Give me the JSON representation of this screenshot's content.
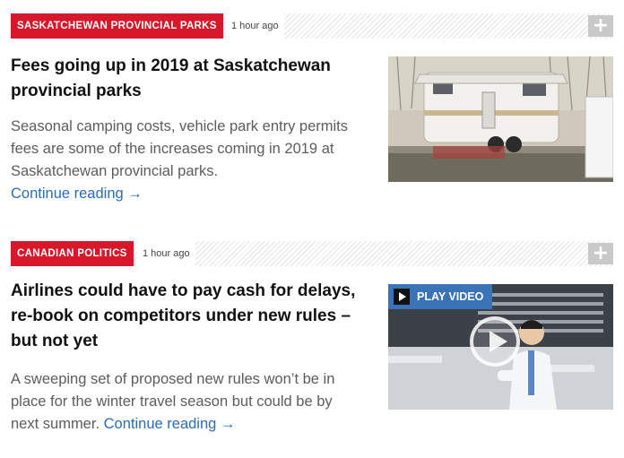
{
  "stories": [
    {
      "category": "SASKATCHEWAN PROVINCIAL PARKS",
      "time": "1 hour ago",
      "headline": "Fees going up in 2019 at Saskatchewan provincial parks",
      "summary": "Seasonal camping costs, vehicle park entry permits fees are some of the increases coming in 2019 at Saskatchewan provincial parks.",
      "continue_label": "Continue reading →",
      "image_subject": "camper trailer at campsite"
    },
    {
      "category": "CANADIAN POLITICS",
      "time": "1 hour ago",
      "headline": "Airlines could have to pay cash for delays, re-book on competitors under new rules – but not yet",
      "summary": "A sweeping set of proposed new rules won’t be in place for the winter travel season but could be by next summer.",
      "continue_label": "Continue reading →",
      "video_label": "PLAY VIDEO",
      "image_subject": "traveller checking watch in airport"
    }
  ],
  "icons": {
    "expand": "plus-icon",
    "play": "play-icon"
  },
  "colors": {
    "category_tag": "#d7182a",
    "link": "#2a6db5",
    "video_badge": "#3b73b8",
    "expand_button": "#c9c9c9"
  }
}
